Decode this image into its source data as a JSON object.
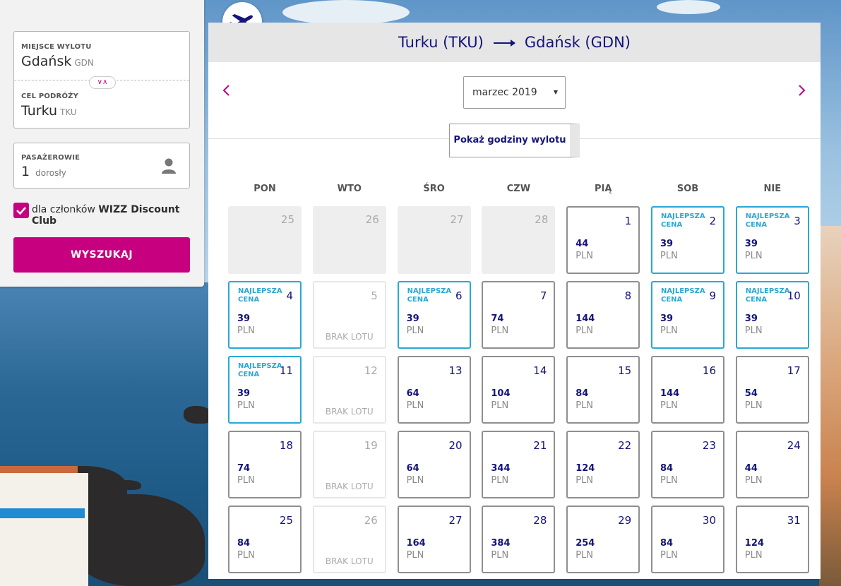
{
  "search": {
    "origin_label": "MIEJSCE WYLOTU",
    "origin_city": "Gdańsk",
    "origin_code": "GDN",
    "destination_label": "CEL PODRÓŻY",
    "destination_city": "Turku",
    "destination_code": "TKU",
    "passengers_label": "PASAŻEROWIE",
    "passengers_count": "1",
    "passengers_unit": "dorosły",
    "wdc_prefix": "dla członków",
    "wdc_bold": "WIZZ Discount Club",
    "search_button": "WYSZUKAJ"
  },
  "calendar": {
    "route_from": "Turku (TKU)",
    "route_to": "Gdańsk (GDN)",
    "month": "marzec 2019",
    "show_times": "Pokaż godziny wylotu",
    "weekdays": [
      "PON",
      "WTO",
      "ŚRO",
      "CZW",
      "PIĄ",
      "SOB",
      "NIE"
    ],
    "best_label": "NAJLEPSZA CENA",
    "no_flight_label": "BRAK LOTU",
    "currency": "PLN",
    "days": [
      {
        "n": "25",
        "state": "past"
      },
      {
        "n": "26",
        "state": "past"
      },
      {
        "n": "27",
        "state": "past"
      },
      {
        "n": "28",
        "state": "past"
      },
      {
        "n": "1",
        "state": "normal",
        "price": "44"
      },
      {
        "n": "2",
        "state": "best",
        "price": "39"
      },
      {
        "n": "3",
        "state": "best",
        "price": "39"
      },
      {
        "n": "4",
        "state": "best",
        "price": "39"
      },
      {
        "n": "5",
        "state": "noflight"
      },
      {
        "n": "6",
        "state": "best",
        "price": "39"
      },
      {
        "n": "7",
        "state": "normal",
        "price": "74"
      },
      {
        "n": "8",
        "state": "normal",
        "price": "144"
      },
      {
        "n": "9",
        "state": "best",
        "price": "39"
      },
      {
        "n": "10",
        "state": "best",
        "price": "39"
      },
      {
        "n": "11",
        "state": "best",
        "price": "39"
      },
      {
        "n": "12",
        "state": "noflight"
      },
      {
        "n": "13",
        "state": "normal",
        "price": "64"
      },
      {
        "n": "14",
        "state": "normal",
        "price": "104"
      },
      {
        "n": "15",
        "state": "normal",
        "price": "84"
      },
      {
        "n": "16",
        "state": "normal",
        "price": "144"
      },
      {
        "n": "17",
        "state": "normal",
        "price": "54"
      },
      {
        "n": "18",
        "state": "normal",
        "price": "74"
      },
      {
        "n": "19",
        "state": "noflight"
      },
      {
        "n": "20",
        "state": "normal",
        "price": "64"
      },
      {
        "n": "21",
        "state": "normal",
        "price": "344"
      },
      {
        "n": "22",
        "state": "normal",
        "price": "124"
      },
      {
        "n": "23",
        "state": "normal",
        "price": "84"
      },
      {
        "n": "24",
        "state": "normal",
        "price": "44"
      },
      {
        "n": "25",
        "state": "normal",
        "price": "84"
      },
      {
        "n": "26",
        "state": "noflight"
      },
      {
        "n": "27",
        "state": "normal",
        "price": "164"
      },
      {
        "n": "28",
        "state": "normal",
        "price": "384"
      },
      {
        "n": "29",
        "state": "normal",
        "price": "254"
      },
      {
        "n": "30",
        "state": "normal",
        "price": "84"
      },
      {
        "n": "31",
        "state": "normal",
        "price": "124"
      }
    ]
  },
  "colors": {
    "brand_magenta": "#c6007e",
    "brand_navy": "#14147a",
    "best_price_blue": "#29a8d6"
  }
}
